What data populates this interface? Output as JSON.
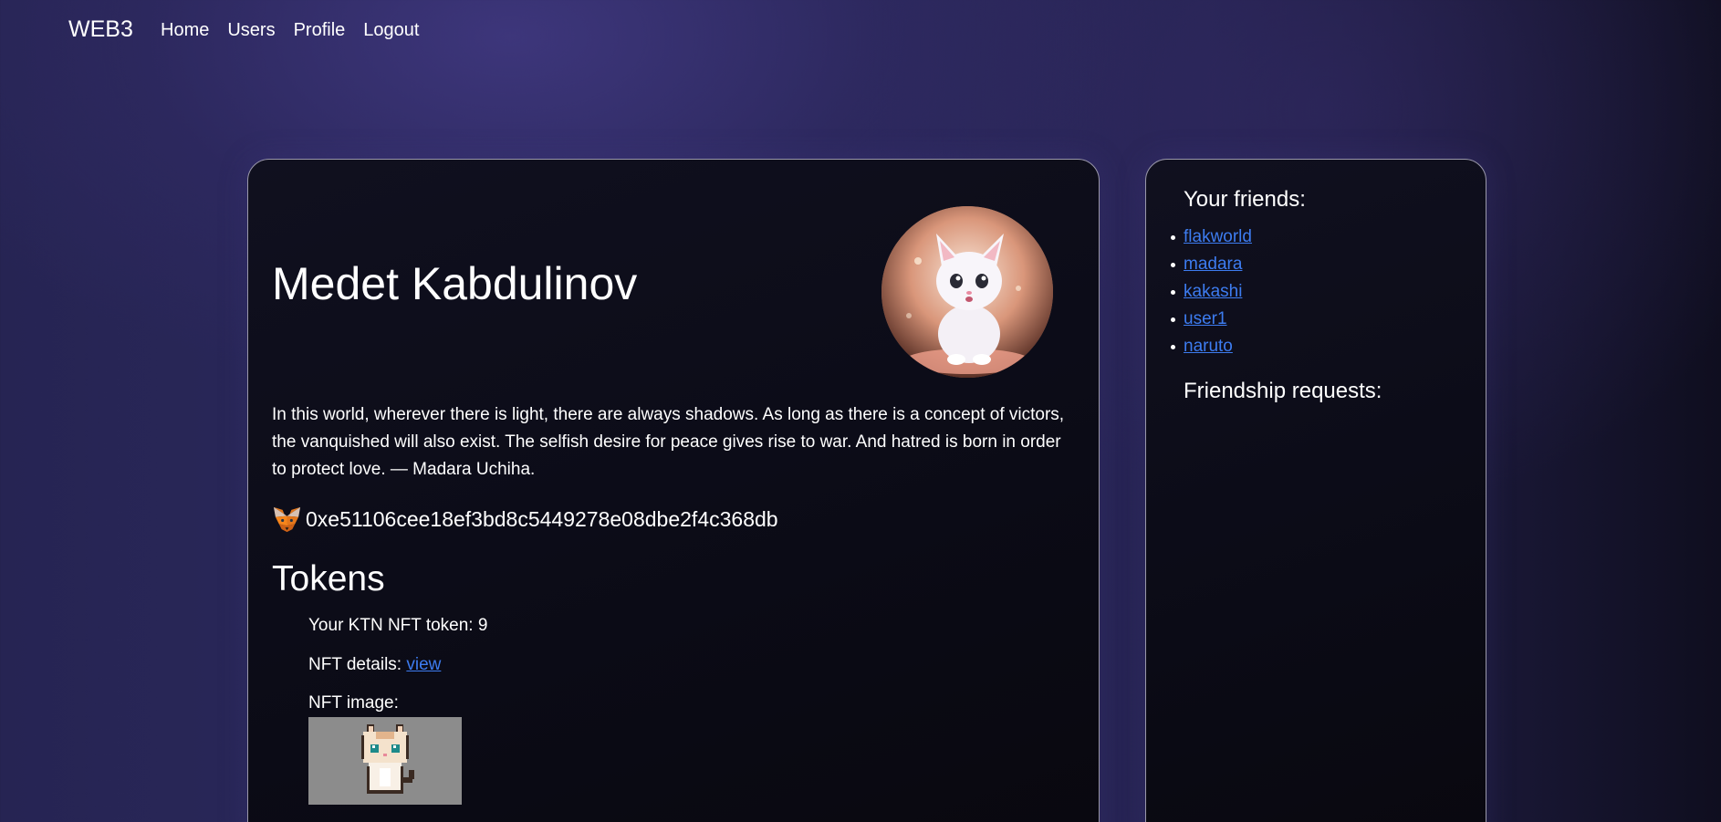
{
  "nav": {
    "brand": "WEB3",
    "links": [
      "Home",
      "Users",
      "Profile",
      "Logout"
    ]
  },
  "profile": {
    "name": "Medet Kabdulinov",
    "bio": "In this world, wherever there is light, there are always shadows. As long as there is a concept of victors, the vanquished will also exist. The selfish desire for peace gives rise to war. And hatred is born in order to protect love. — Madara Uchiha.",
    "wallet_address": "0xe51106cee18ef3bd8c5449278e08dbe2f4c368db",
    "wallet_icon": "metamask-fox-icon",
    "avatar_alt": "white-kitten-avatar"
  },
  "tokens": {
    "heading": "Tokens",
    "token_label": "Your KTN NFT token: 9",
    "details_label": "NFT details: ",
    "details_link": "view",
    "image_label": "NFT image:"
  },
  "friends": {
    "title": "Your friends:",
    "items": [
      "flakworld",
      "madara",
      "kakashi",
      "user1",
      "naruto"
    ],
    "requests_title": "Friendship requests:"
  },
  "colors": {
    "link": "#3d7cf0",
    "card_border": "#9a98aa",
    "card_bg": "#0b0b16",
    "page_bg": "#2c2a5e"
  }
}
